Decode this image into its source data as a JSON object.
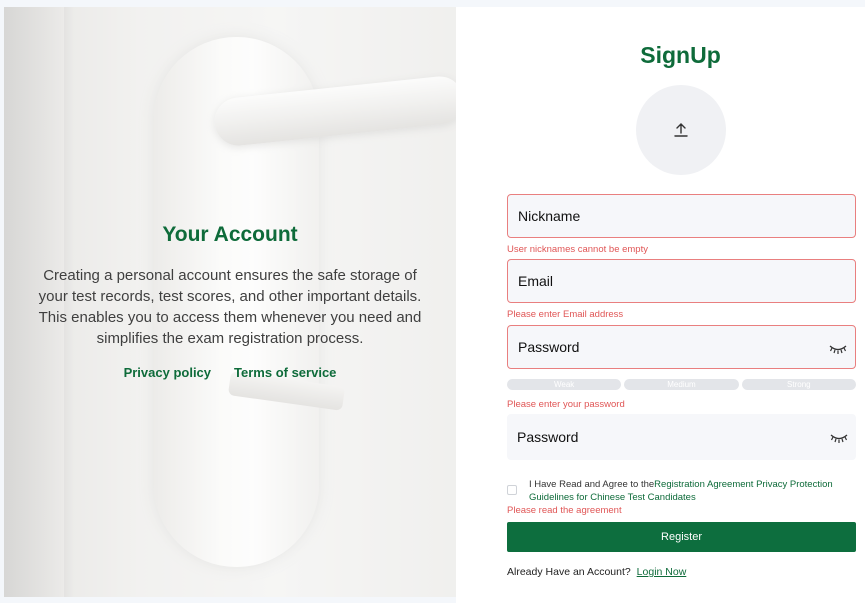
{
  "left": {
    "title": "Your Account",
    "description": "Creating a personal account ensures the safe storage of your test records, test scores, and other important details. This enables you to access them whenever you need and simplifies the exam registration process.",
    "privacy_link": "Privacy policy",
    "terms_link": "Terms of service"
  },
  "form": {
    "title": "SignUp",
    "avatar_icon": "upload-icon",
    "nickname": {
      "label": "Nickname",
      "error": "User nicknames cannot be empty"
    },
    "email": {
      "label": "Email",
      "error": "Please enter Email address"
    },
    "password": {
      "label": "Password",
      "error": "Please enter your password",
      "icon": "eye-closed-icon"
    },
    "strength": [
      "Weak",
      "Medium",
      "Strong"
    ],
    "confirm_password": {
      "label": "Password",
      "icon": "eye-closed-icon"
    },
    "agreement": {
      "prefix": "I Have Read and Agree to the",
      "link": "Registration Agreement Privacy Protection Guidelines for Chinese Test Candidates",
      "error": "Please read the agreement"
    },
    "register_label": "Register",
    "login_prompt": "Already Have an Account?",
    "login_link": "Login Now"
  },
  "colors": {
    "brand_green": "#0e6b3a",
    "error_red": "#e05656",
    "input_bg": "#f6f7fa"
  }
}
